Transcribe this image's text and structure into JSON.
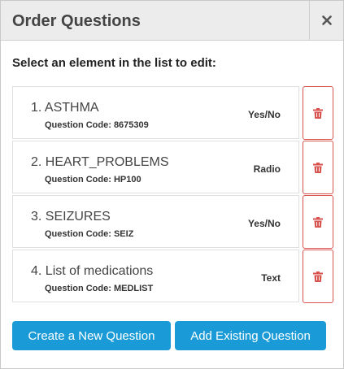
{
  "dialog": {
    "title": "Order Questions",
    "close_icon": "close-icon",
    "instruction": "Select an element in the list to edit:"
  },
  "questions": [
    {
      "name": "1. ASTHMA",
      "code": "Question Code: 8675309",
      "type": "Yes/No"
    },
    {
      "name": "2. HEART_PROBLEMS",
      "code": "Question Code: HP100",
      "type": "Radio"
    },
    {
      "name": "3. SEIZURES",
      "code": "Question Code: SEIZ",
      "type": "Yes/No"
    },
    {
      "name": "4. List of medications",
      "code": "Question Code: MEDLIST",
      "type": "Text"
    }
  ],
  "delete_icon": "trash-icon",
  "buttons": {
    "create": "Create a New Question",
    "add_existing": "Add Existing Question"
  },
  "colors": {
    "primary_button": "#1a9bd7",
    "delete_accent": "#d9534f",
    "header_bg": "#ececec"
  }
}
